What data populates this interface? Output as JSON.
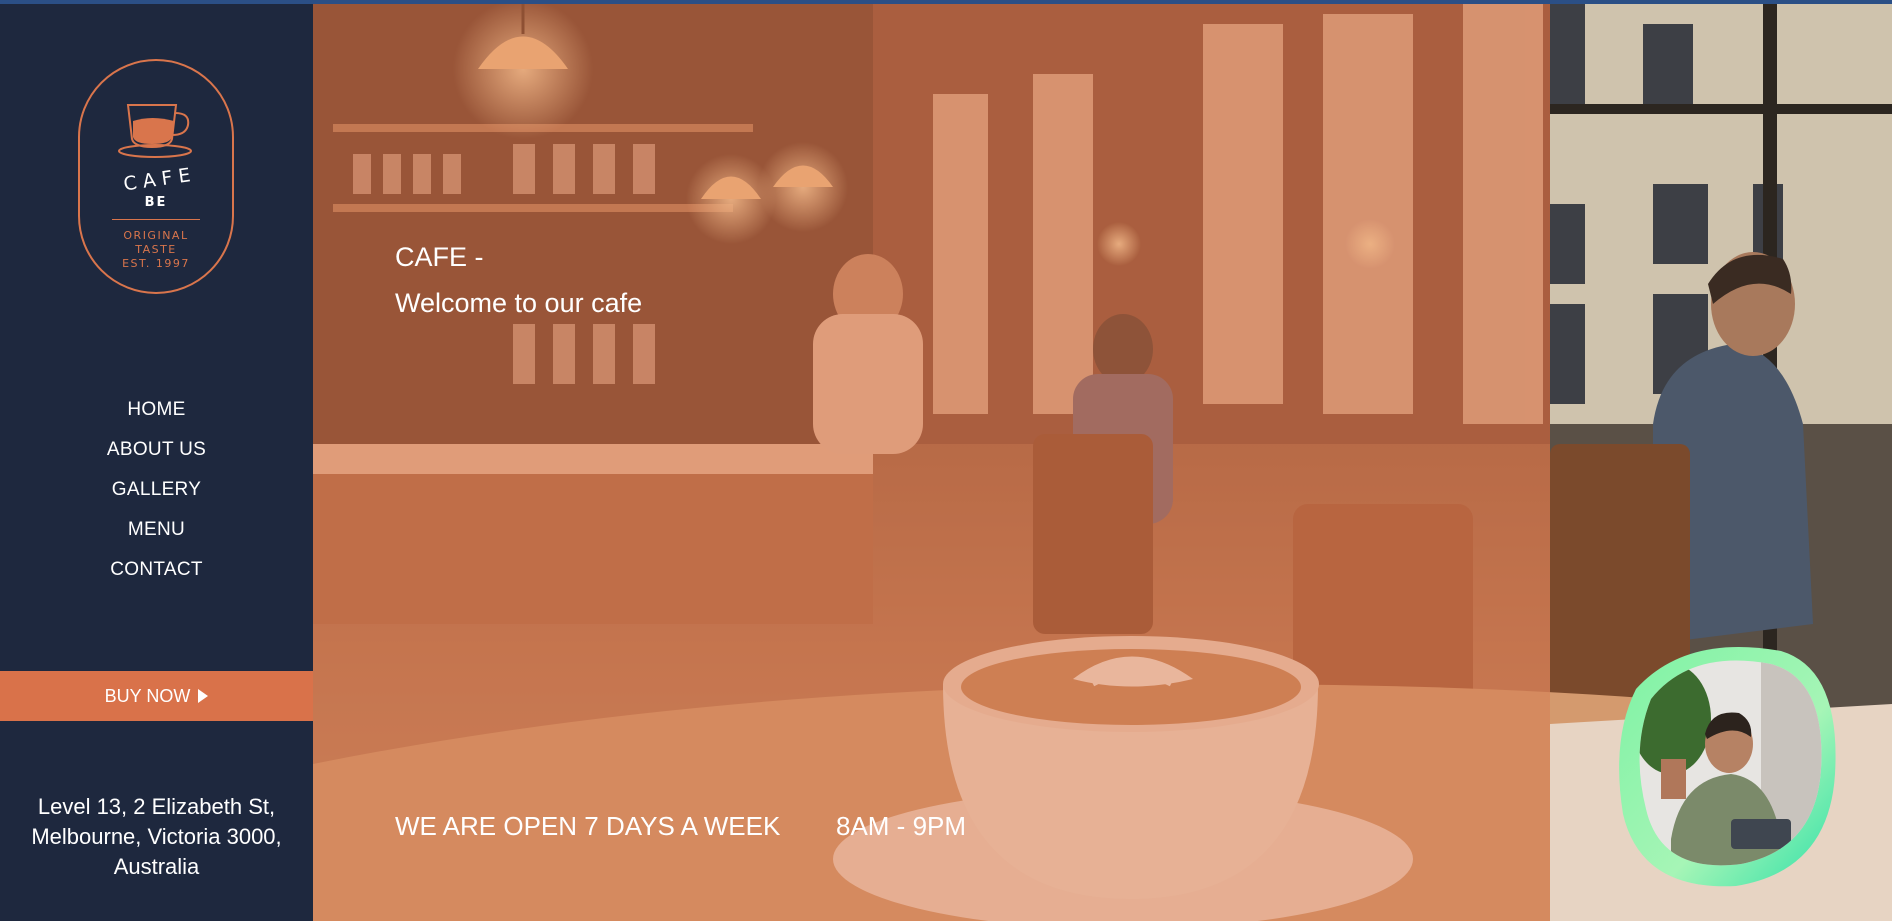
{
  "brand": {
    "name": "CAFE",
    "sub": "BE",
    "tagline": [
      "ORIGINAL",
      "TASTE",
      "EST. 1997"
    ],
    "icon": "coffee-cup-icon"
  },
  "nav": {
    "items": [
      {
        "label": "HOME"
      },
      {
        "label": "ABOUT US"
      },
      {
        "label": "GALLERY"
      },
      {
        "label": "MENU"
      },
      {
        "label": "CONTACT"
      }
    ]
  },
  "cta": {
    "label": "BUY NOW",
    "icon": "play-arrow-icon"
  },
  "address": {
    "line1": "Level 13, 2 Elizabeth St,",
    "line2": "Melbourne, Victoria 3000,",
    "line3": "Australia"
  },
  "hero": {
    "title": "CAFE -",
    "subtitle": "Welcome to our cafe",
    "open_text": "WE ARE OPEN 7 DAYS A WEEK",
    "hours": "8AM - 9PM"
  },
  "colors": {
    "sidebar": "#1e283e",
    "accent": "#d9724a",
    "text": "#ffffff"
  }
}
